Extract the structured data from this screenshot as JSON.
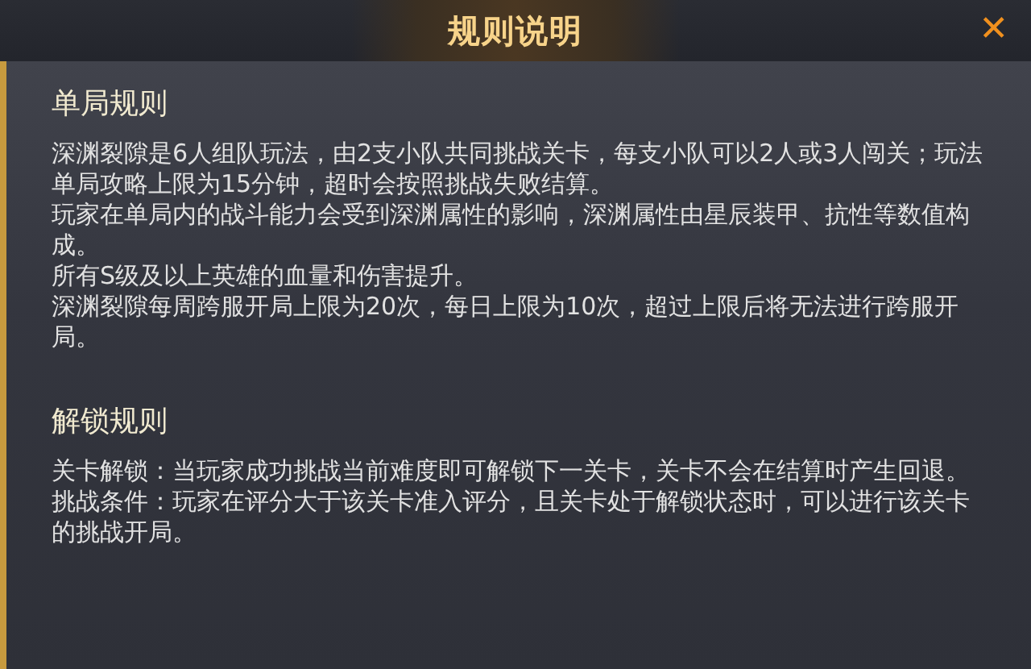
{
  "dialog": {
    "title": "规则说明",
    "close_icon": "✕"
  },
  "sections": [
    {
      "heading": "单局规则",
      "paragraphs": [
        "深渊裂隙是6人组队玩法，由2支小队共同挑战关卡，每支小队可以2人或3人闯关；玩法单局攻略上限为15分钟，超时会按照挑战失败结算。",
        "玩家在单局内的战斗能力会受到深渊属性的影响，深渊属性由星辰装甲、抗性等数值构成。",
        "所有S级及以上英雄的血量和伤害提升。",
        "深渊裂隙每周跨服开局上限为20次，每日上限为10次，超过上限后将无法进行跨服开局。"
      ]
    },
    {
      "heading": "解锁规则",
      "paragraphs": [
        "关卡解锁：当玩家成功挑战当前难度即可解锁下一关卡，关卡不会在结算时产生回退。",
        "挑战条件：玩家在评分大于该关卡准入评分，且关卡处于解锁状态时，可以进行该关卡的挑战开局。"
      ]
    }
  ]
}
